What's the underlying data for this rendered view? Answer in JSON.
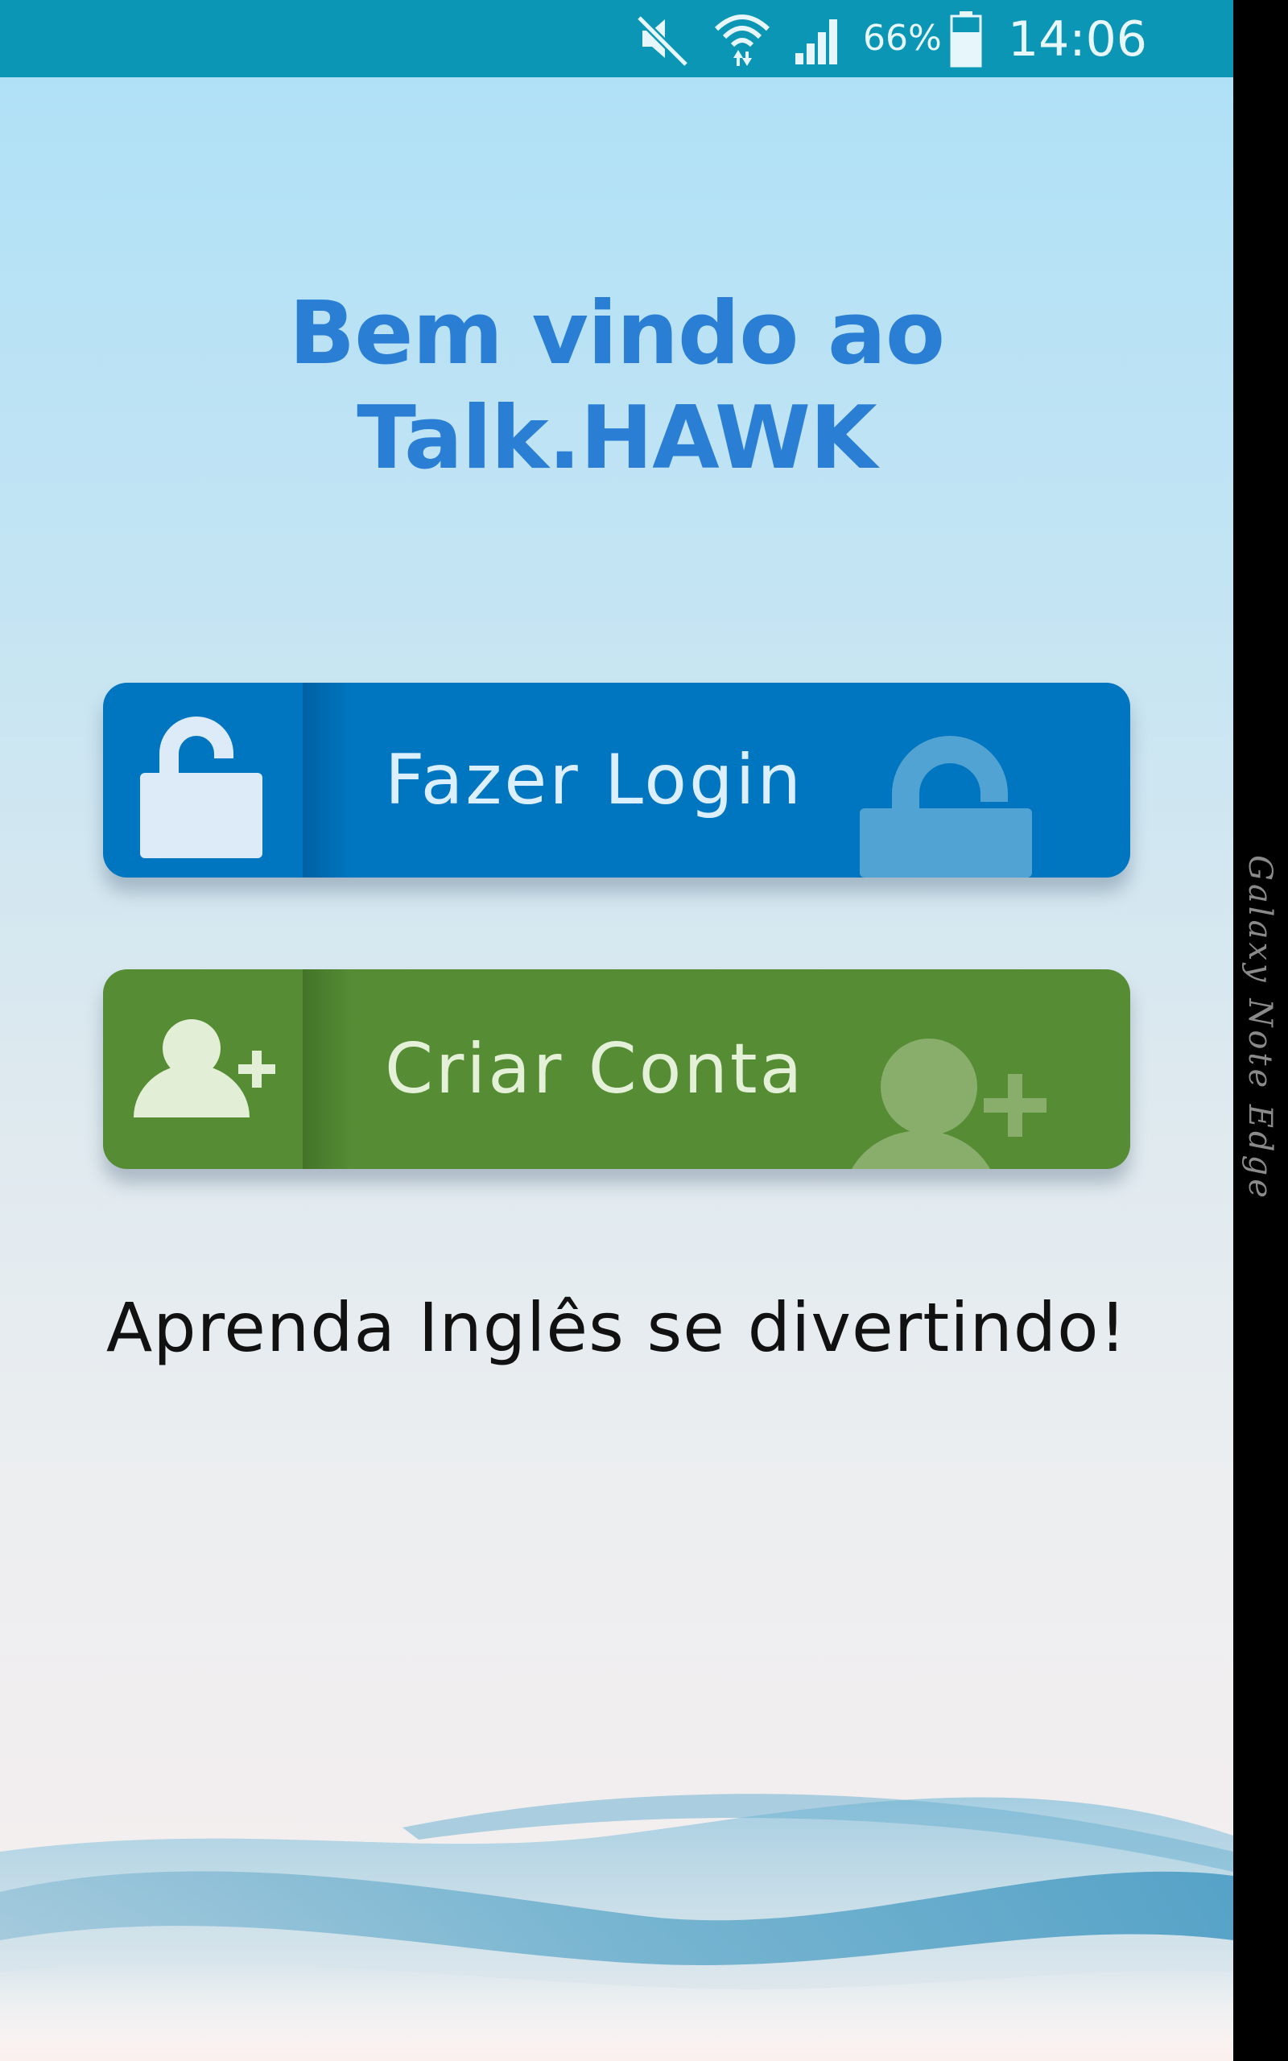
{
  "status_bar": {
    "battery_percent": "66%",
    "time": "14:06",
    "icons": [
      "mute-icon",
      "wifi-icon",
      "signal-icon",
      "battery-icon"
    ]
  },
  "welcome": {
    "line1": "Bem vindo ao",
    "line2": "Talk.HAWK"
  },
  "buttons": {
    "login": {
      "label": "Fazer Login",
      "icon": "unlocked-padlock-icon",
      "color": "#0076c0"
    },
    "signup": {
      "label": "Criar Conta",
      "icon": "add-user-icon",
      "color": "#558c34"
    }
  },
  "tagline": "Aprenda Inglês se divertindo!",
  "device_edge": {
    "label": "Galaxy Note Edge"
  },
  "colors": {
    "status_bar": "#0a96b4",
    "title": "#2a7fd4"
  }
}
